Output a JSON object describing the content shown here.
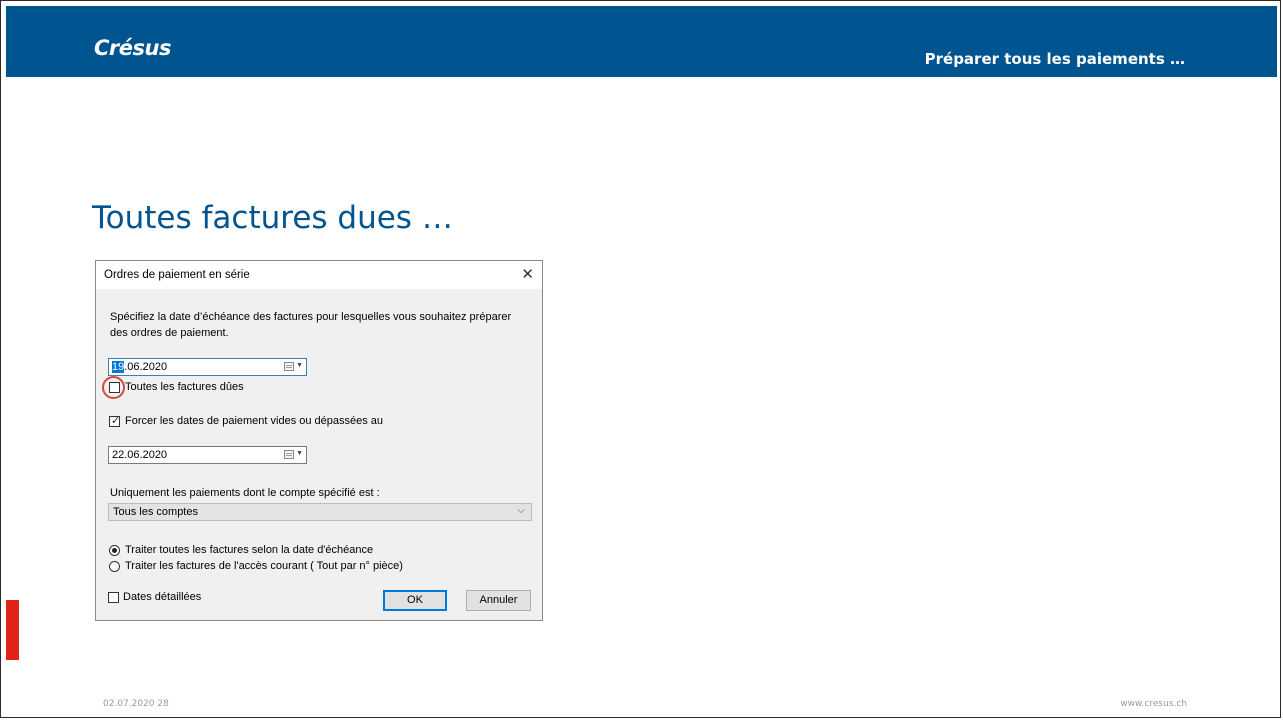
{
  "header": {
    "logo_text": "Crésus",
    "title": "Préparer tous les paiements …",
    "background": "#00548f"
  },
  "slide": {
    "title": "Toutes factures dues …",
    "accent_bar_color": "#e2231a"
  },
  "dialog": {
    "title": "Ordres de paiement en série",
    "close_icon": "close-icon",
    "intro_line1": "Spécifiez la date d’échéance des factures pour lesquelles vous souhaitez préparer",
    "intro_line2": "des ordres de paiement.",
    "due_date": {
      "selected_part": "19",
      "rest": ".06.2020"
    },
    "all_due_checkbox": {
      "label": "Toutes les factures dûes",
      "checked": false,
      "highlighted": true
    },
    "force_dates_checkbox": {
      "label": "Forcer les dates de paiement vides ou dépassées au",
      "checked": true
    },
    "forced_date": "22.06.2020",
    "account_label": "Uniquement les paiements dont le compte spécifié est :",
    "account_select": "Tous les comptes",
    "radio_options": [
      {
        "label": "Traiter toutes les factures selon la date d'échéance",
        "selected": true
      },
      {
        "label": "Traiter les factures de l'accès courant ( Tout par n° pièce)",
        "selected": false
      }
    ],
    "detailed_dates_checkbox": {
      "label": "Dates détaillées",
      "checked": false
    },
    "ok_label": "OK",
    "cancel_label": "Annuler"
  },
  "footer": {
    "left": "02.07.2020 28",
    "right": "www.cresus.ch"
  }
}
